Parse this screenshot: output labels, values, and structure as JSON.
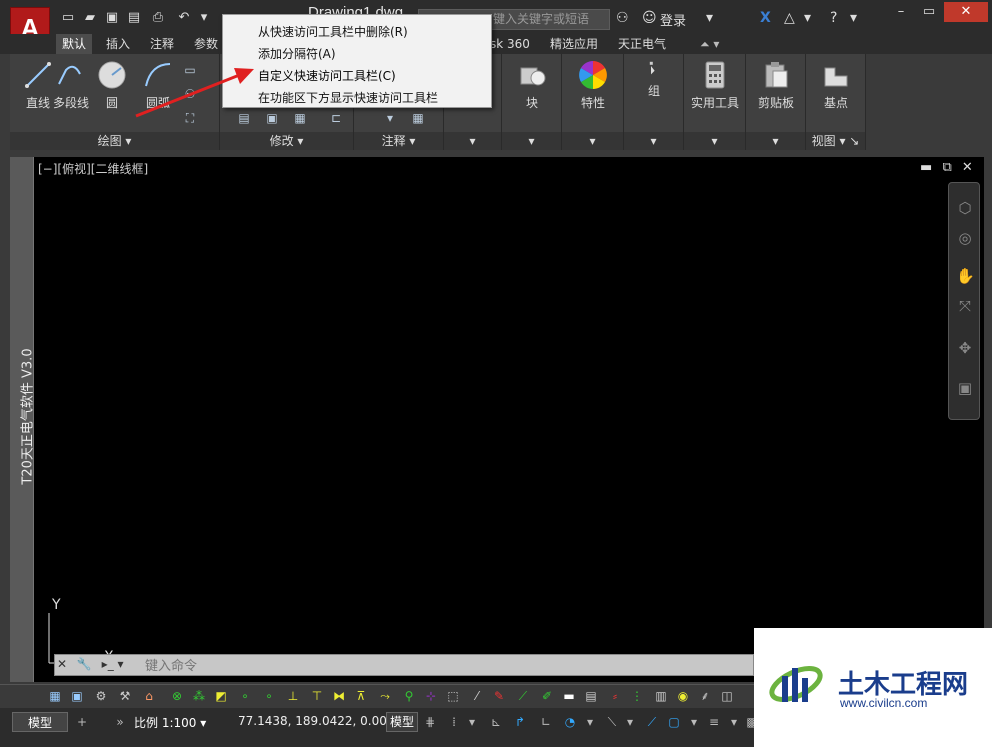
{
  "app": {
    "logo_letter": "A",
    "title": "Drawing1.dwg",
    "search_placeholder": "键入关键字或短语",
    "login_label": "登录"
  },
  "ribbon": {
    "tabs": [
      {
        "label": "默认",
        "active": true
      },
      {
        "label": "插入"
      },
      {
        "label": "注释"
      },
      {
        "label": "参数"
      },
      {
        "label": "sk 360"
      },
      {
        "label": "精选应用"
      },
      {
        "label": "天正电气"
      }
    ],
    "panels": {
      "draw": {
        "title": "绘图",
        "buttons": [
          {
            "label": "直线",
            "icon": "line-icon"
          },
          {
            "label": "多段线",
            "icon": "polyline-icon"
          },
          {
            "label": "圆",
            "icon": "circle-icon"
          },
          {
            "label": "圆弧",
            "icon": "arc-icon"
          }
        ]
      },
      "modify": {
        "title": "修改"
      },
      "annotate": {
        "title": "注释"
      },
      "block": {
        "label": "块"
      },
      "properties": {
        "label": "特性"
      },
      "group": {
        "label": "组"
      },
      "utilities": {
        "label": "实用工具"
      },
      "clipboard": {
        "label": "剪贴板"
      },
      "view": {
        "title": "视图",
        "base_label": "基点"
      }
    }
  },
  "context_menu": {
    "items": [
      "从快速访问工具栏中删除(R)",
      "添加分隔符(A)",
      "自定义快速访问工具栏(C)",
      "在功能区下方显示快速访问工具栏"
    ]
  },
  "viewport": {
    "label": "[−][俯视][二维线框]",
    "side_title": "T20天正电气软件 V3.0",
    "ucs_y": "Y",
    "ucs_x": "X"
  },
  "command_line": {
    "placeholder": "键入命令"
  },
  "status_bar": {
    "model_tab": "模型",
    "scale_label": "比例 1:100",
    "coordinates": "77.1438, 189.0422, 0.0000",
    "model_button": "模型"
  },
  "watermark": {
    "chinese": "土木工程网",
    "url": "www.civilcn.com"
  },
  "colors": {
    "accent_red": "#b11a1a",
    "canvas": "#000000",
    "watermark_blue": "#1a3d8c"
  }
}
